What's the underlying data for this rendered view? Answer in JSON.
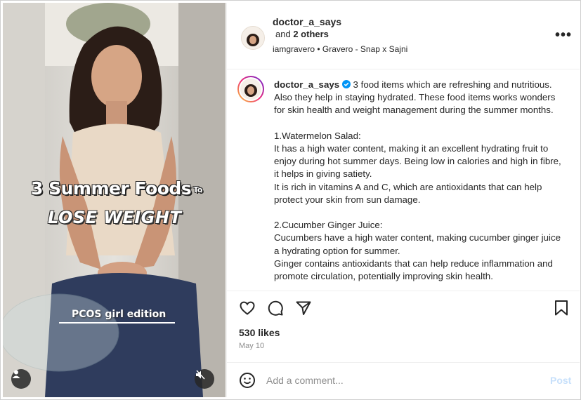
{
  "video": {
    "title_line1": "3 Summer Foods",
    "title_small": "To",
    "title_line2": "LOSE WEIGHT",
    "tag": "PCOS girl edition",
    "user_icon": "user-icon",
    "mute_icon": "muted-speaker-icon"
  },
  "header": {
    "username": "doctor_a_says",
    "collab_prefix": "and",
    "collab_others": "2 others",
    "audio": "iamgravero • Gravero - Snap x Sajni",
    "more_label": "•••"
  },
  "caption": {
    "username": "doctor_a_says",
    "verified_icon": "verified-badge-icon",
    "intro": "3 food items which are refreshing and nutritious. Also they help in staying hydrated. These food items works wonders for skin health and weight management during the summer months.",
    "item1_title": "1.Watermelon Salad:",
    "item1_p1": "It has a high water content, making it an excellent hydrating fruit to enjoy during hot summer days. Being low in calories and high in fibre, it helps in giving satiety.",
    "item1_p2": "It is rich in vitamins A and C, which are antioxidants that can help protect your skin from sun damage.",
    "item2_title": "2.Cucumber Ginger Juice:",
    "item2_p1": "Cucumbers have a high water content, making cucumber ginger juice a hydrating option for summer.",
    "item2_p2": "Ginger contains antioxidants that can help reduce inflammation and promote circulation, potentially improving skin health."
  },
  "actions": {
    "like_icon": "heart-icon",
    "comment_icon": "comment-bubble-icon",
    "share_icon": "paper-plane-icon",
    "save_icon": "bookmark-icon"
  },
  "stats": {
    "likes": "530 likes",
    "date": "May 10"
  },
  "comment": {
    "emoji_icon": "emoji-icon",
    "placeholder": "Add a comment...",
    "post_label": "Post"
  },
  "colors": {
    "text": "#262626",
    "muted": "#8e8e8e",
    "verified": "#0095f6",
    "post_disabled": "#c7e0fb"
  }
}
